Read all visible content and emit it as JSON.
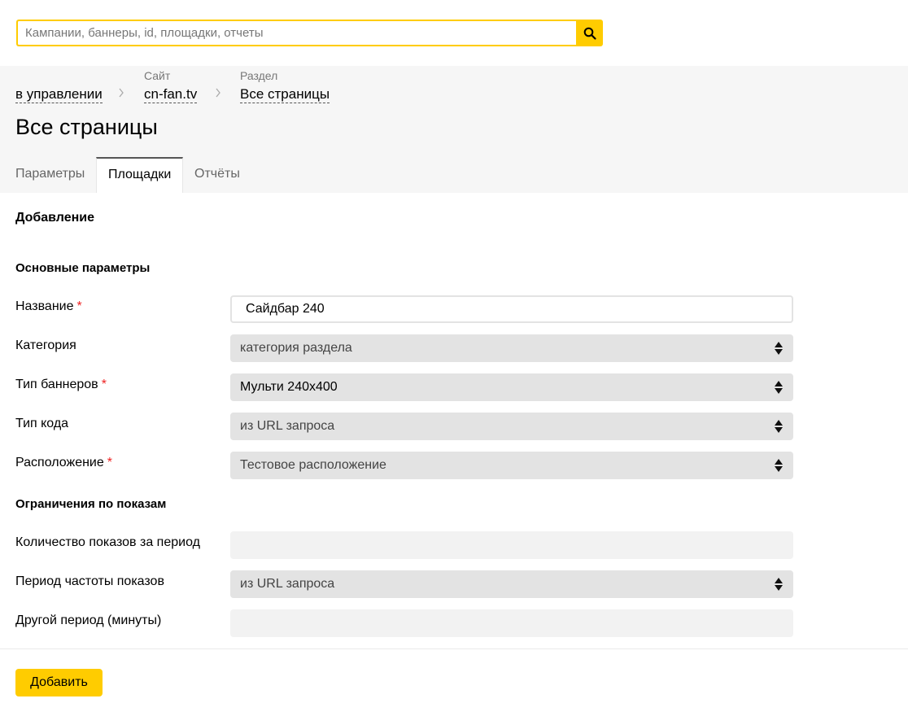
{
  "search": {
    "placeholder": "Кампании, баннеры, id, площадки, отчеты",
    "value": "",
    "icon": "search-icon"
  },
  "breadcrumbs": [
    {
      "caption": "",
      "label": "в управлении"
    },
    {
      "caption": "Сайт",
      "label": "cn-fan.tv"
    },
    {
      "caption": "Раздел",
      "label": "Все страницы"
    }
  ],
  "page_title": "Все страницы",
  "tabs": [
    {
      "label": "Параметры",
      "active": false
    },
    {
      "label": "Площадки",
      "active": true
    },
    {
      "label": "Отчёты",
      "active": false
    }
  ],
  "form": {
    "heading": "Добавление",
    "main_section": "Основные параметры",
    "required_mark": "*",
    "fields": [
      {
        "label": "Название",
        "required": true,
        "type": "text",
        "value": "Сайдбар 240"
      },
      {
        "label": "Категория",
        "required": false,
        "type": "select",
        "value": "категория раздела"
      },
      {
        "label": "Тип баннеров",
        "required": true,
        "type": "select",
        "value": "Мульти 240x400"
      },
      {
        "label": "Тип кода",
        "required": false,
        "type": "select",
        "value": "из URL запроса"
      },
      {
        "label": "Расположение",
        "required": true,
        "type": "select",
        "value": "Тестовое расположение"
      }
    ],
    "limits_section": "Ограничения по показам",
    "limit_fields": [
      {
        "label": "Количество показов за период",
        "type": "text",
        "value": ""
      },
      {
        "label": "Период частоты показов",
        "type": "select",
        "value": "из URL запроса"
      },
      {
        "label": "Другой период (минуты)",
        "type": "text",
        "value": ""
      }
    ],
    "submit_label": "Добавить"
  },
  "colors": {
    "accent": "#ffcc00",
    "required": "#ee2222",
    "band": "#f6f6f6",
    "select_bg": "#e3e3e3"
  }
}
